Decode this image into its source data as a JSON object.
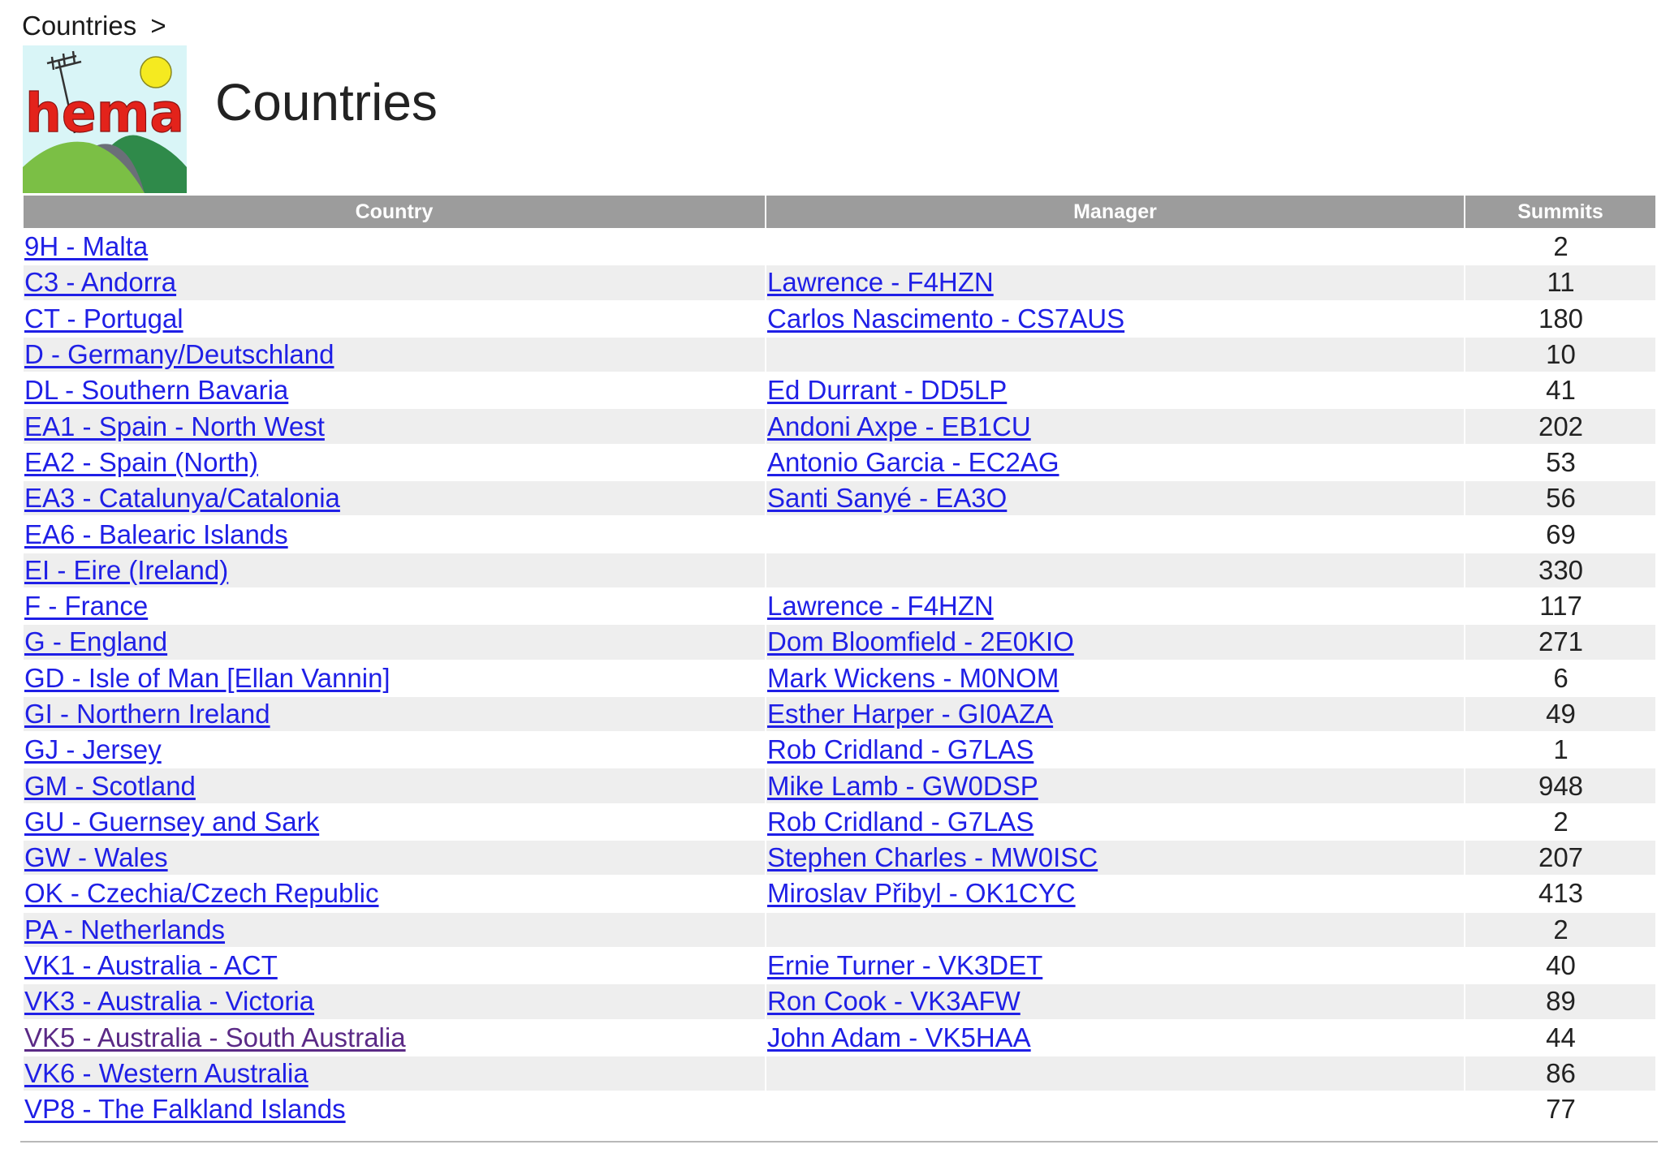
{
  "breadcrumb": {
    "item": "Countries",
    "separator": ">"
  },
  "logo": {
    "text": "hema",
    "colors": {
      "sky": "#d9f5f7",
      "sun": "#f5ea20",
      "text": "#e3231b",
      "hill_front": "#7bbf45",
      "hill_back": "#2f8a4a",
      "hill_grey": "#6b6f78"
    }
  },
  "page_title": "Countries",
  "table": {
    "headers": {
      "country": "Country",
      "manager": "Manager",
      "summits": "Summits"
    },
    "rows": [
      {
        "country": "9H - Malta",
        "manager": "",
        "summits": "2",
        "visited": false
      },
      {
        "country": "C3 - Andorra",
        "manager": "Lawrence - F4HZN",
        "summits": "11",
        "visited": false
      },
      {
        "country": "CT - Portugal",
        "manager": "Carlos Nascimento - CS7AUS",
        "summits": "180",
        "visited": false
      },
      {
        "country": "D - Germany/Deutschland",
        "manager": "",
        "summits": "10",
        "visited": false
      },
      {
        "country": "DL - Southern Bavaria",
        "manager": "Ed Durrant - DD5LP",
        "summits": "41",
        "visited": false
      },
      {
        "country": "EA1 - Spain - North West",
        "manager": "Andoni Axpe - EB1CU",
        "summits": "202",
        "visited": false
      },
      {
        "country": "EA2 - Spain (North)",
        "manager": "Antonio Garcia - EC2AG",
        "summits": "53",
        "visited": false
      },
      {
        "country": "EA3 - Catalunya/Catalonia",
        "manager": "Santi Sanyé - EA3O",
        "summits": "56",
        "visited": false
      },
      {
        "country": "EA6 - Balearic Islands",
        "manager": "",
        "summits": "69",
        "visited": false
      },
      {
        "country": "EI - Eire (Ireland)",
        "manager": "",
        "summits": "330",
        "visited": false
      },
      {
        "country": "F - France",
        "manager": "Lawrence - F4HZN",
        "summits": "117",
        "visited": false
      },
      {
        "country": "G - England",
        "manager": "Dom Bloomfield - 2E0KIO",
        "summits": "271",
        "visited": false
      },
      {
        "country": "GD - Isle of Man [Ellan Vannin]",
        "manager": "Mark Wickens - M0NOM",
        "summits": "6",
        "visited": false
      },
      {
        "country": "GI - Northern Ireland",
        "manager": "Esther Harper - GI0AZA",
        "summits": "49",
        "visited": false
      },
      {
        "country": "GJ - Jersey",
        "manager": "Rob Cridland - G7LAS",
        "summits": "1",
        "visited": false
      },
      {
        "country": "GM - Scotland",
        "manager": "Mike Lamb - GW0DSP",
        "summits": "948",
        "visited": false
      },
      {
        "country": "GU - Guernsey and Sark",
        "manager": "Rob Cridland - G7LAS",
        "summits": "2",
        "visited": false
      },
      {
        "country": "GW - Wales",
        "manager": "Stephen Charles - MW0ISC",
        "summits": "207",
        "visited": false
      },
      {
        "country": "OK - Czechia/Czech Republic",
        "manager": "Miroslav Přibyl - OK1CYC",
        "summits": "413",
        "visited": false
      },
      {
        "country": "PA - Netherlands",
        "manager": "",
        "summits": "2",
        "visited": false
      },
      {
        "country": "VK1 - Australia - ACT",
        "manager": "Ernie Turner - VK3DET",
        "summits": "40",
        "visited": false
      },
      {
        "country": "VK3 - Australia - Victoria",
        "manager": "Ron Cook - VK3AFW",
        "summits": "89",
        "visited": false
      },
      {
        "country": "VK5 - Australia - South Australia",
        "manager": "John Adam - VK5HAA",
        "summits": "44",
        "visited": true
      },
      {
        "country": "VK6 - Western Australia",
        "manager": "",
        "summits": "86",
        "visited": false
      },
      {
        "country": "VP8 - The Falkland Islands",
        "manager": "",
        "summits": "77",
        "visited": false
      }
    ]
  },
  "colors": {
    "link": "#1f1fe6",
    "visited_link": "#5b2a86",
    "header_bg": "#9c9c9c",
    "stripe_bg": "#eeeeee"
  }
}
